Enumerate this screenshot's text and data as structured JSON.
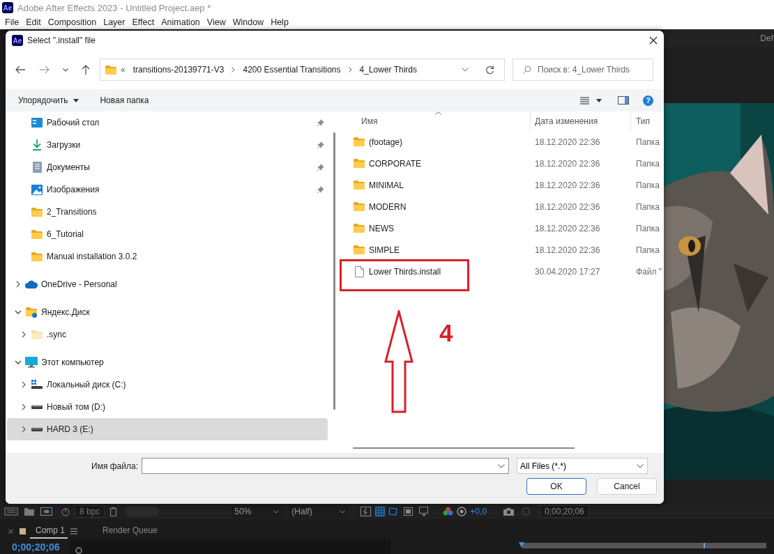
{
  "app": {
    "logo": "Ae",
    "title": "Adobe After Effects 2023 - Untitled Project.aep *"
  },
  "menu": [
    "File",
    "Edit",
    "Composition",
    "Layer",
    "Effect",
    "Animation",
    "View",
    "Window",
    "Help"
  ],
  "workspace_label": "Def",
  "toolbar": {
    "bit_depth": "8 bpc",
    "zoom": "50%",
    "resolution": "(Half)",
    "exposure": "+0,0",
    "timecode": "0;00;20;06"
  },
  "panel_tabs": [
    {
      "label": "Comp 1",
      "selected": true,
      "color": "#c9b287"
    },
    {
      "label": "Render Queue",
      "selected": false
    }
  ],
  "timeline": {
    "timecode": "0;00;20;06"
  },
  "dialog": {
    "logo": "Ae",
    "title": "Select \".install\" file",
    "path_prefix": "«",
    "path": [
      "transitions-20139771-V3",
      "4200 Essential Transitions",
      "4_Lower Thirds"
    ],
    "search": {
      "placeholder": "Поиск в: 4_Lower Thirds"
    },
    "commands": [
      {
        "label": "Упорядочить",
        "menu": true
      },
      {
        "label": "Новая папка",
        "menu": false
      }
    ],
    "help": "?",
    "quick_access": [
      {
        "label": "Рабочий стол",
        "kind": "desktop",
        "pinned": true
      },
      {
        "label": "Загрузки",
        "kind": "downloads",
        "pinned": true
      },
      {
        "label": "Документы",
        "kind": "documents",
        "pinned": true
      },
      {
        "label": "Изображения",
        "kind": "pictures",
        "pinned": true
      },
      {
        "label": "2_Transitions",
        "kind": "folder",
        "pinned": false
      },
      {
        "label": "6_Tutorial",
        "kind": "folder",
        "pinned": false
      },
      {
        "label": "Manual installation 3.0.2",
        "kind": "folder",
        "pinned": false
      }
    ],
    "tree": [
      {
        "label": "OneDrive - Personal",
        "kind": "cloud",
        "expanded": false,
        "selected": false
      },
      {
        "label": "Яндекс.Диск",
        "kind": "yandex",
        "expanded": true,
        "selected": false,
        "children": [
          {
            "label": ".sync",
            "kind": "hidden-folder",
            "expanded": false,
            "selected": false
          }
        ]
      },
      {
        "label": "Этот компьютер",
        "kind": "computer",
        "expanded": true,
        "selected": false,
        "children": [
          {
            "label": "Локальный диск (C:)",
            "kind": "system-drive",
            "expanded": false,
            "selected": false
          },
          {
            "label": "Новый том (D:)",
            "kind": "drive",
            "expanded": false,
            "selected": false
          },
          {
            "label": "HARD 3 (E:)",
            "kind": "drive",
            "expanded": false,
            "selected": true
          }
        ]
      }
    ],
    "columns": [
      {
        "label": "Имя",
        "sorted": true
      },
      {
        "label": "Дата изменения",
        "sorted": false
      },
      {
        "label": "Тип",
        "sorted": false
      }
    ],
    "files": [
      {
        "name": "(footage)",
        "kind": "folder",
        "modified": "18.12.2020 22:36",
        "type": "Папка"
      },
      {
        "name": "CORPORATE",
        "kind": "folder",
        "modified": "18.12.2020 22:36",
        "type": "Папка"
      },
      {
        "name": "MINIMAL",
        "kind": "folder",
        "modified": "18.12.2020 22:36",
        "type": "Папка"
      },
      {
        "name": "MODERN",
        "kind": "folder",
        "modified": "18.12.2020 22:36",
        "type": "Папка"
      },
      {
        "name": "NEWS",
        "kind": "folder",
        "modified": "18.12.2020 22:36",
        "type": "Папка"
      },
      {
        "name": "SIMPLE",
        "kind": "folder",
        "modified": "18.12.2020 22:36",
        "type": "Папка"
      },
      {
        "name": "Lower Thirds.install",
        "kind": "file",
        "modified": "30.04.2020 17:27",
        "type": "Файл \""
      }
    ],
    "file_name": {
      "label": "Имя файла:"
    },
    "filter": "All Files (*.*)",
    "buttons": [
      {
        "label": "OK",
        "default": true
      },
      {
        "label": "Cancel",
        "default": false
      }
    ]
  },
  "annotation": {
    "label": "4"
  }
}
